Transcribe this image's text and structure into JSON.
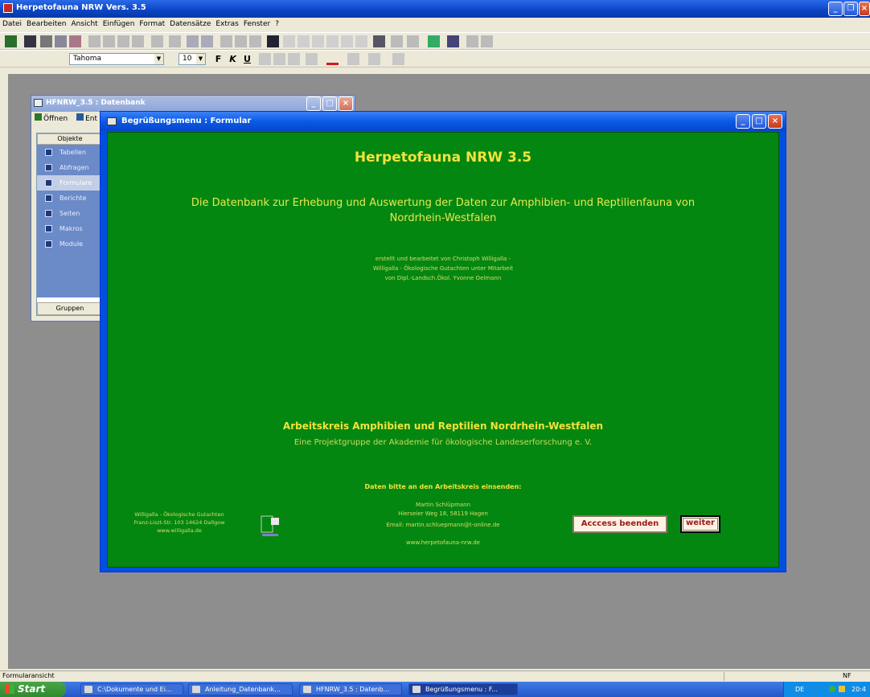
{
  "app": {
    "title": "Herpetofauna NRW Vers. 3.5"
  },
  "menu": [
    "Datei",
    "Bearbeiten",
    "Ansicht",
    "Einfügen",
    "Format",
    "Datensätze",
    "Extras",
    "Fenster",
    "?"
  ],
  "formatting": {
    "font_name": "Tahoma",
    "font_size": "10",
    "bold_label": "F",
    "italic_label": "K",
    "underline_label": "U"
  },
  "db_window": {
    "title": "HFNRW_3.5 : Datenbank",
    "open_label": "Öffnen",
    "design_label": "Ent",
    "objects_header": "Objekte",
    "objects": [
      "Tabellen",
      "Abfragen",
      "Formulare",
      "Berichte",
      "Seiten",
      "Makros",
      "Module"
    ],
    "selected_object": "Formulare",
    "groups_label": "Gruppen"
  },
  "form": {
    "window_title": "Begrüßungsmenu : Formular",
    "heading": "Herpetofauna NRW 3.5",
    "subtitle_line1": "Die Datenbank zur Erhebung und Auswertung der Daten zur Amphibien- und Reptilienfauna von",
    "subtitle_line2": "Nordrhein-Westfalen",
    "credits_line1": "erstellt und bearbeitet von Christoph Willigalla -",
    "credits_line2": "Willigalla - Ökologische Gutachten unter Mitarbeit",
    "credits_line3": "von Dipl.-Landsch.Ökol. Yvonne Oelmann",
    "org_title": "Arbeitskreis Amphibien und Reptilien Nordrhein-Westfalen",
    "org_subtitle": "Eine Projektgruppe der Akademie für ökologische Landeserforschung e. V.",
    "send_heading": "Daten bitte an den Arbeitskreis einsenden:",
    "contact_name": "Martin Schlüpmann",
    "contact_address": "Hierseier Weg 18, 58119 Hagen",
    "contact_email": "Email: martin.schluepmann@t-online.de",
    "website": "www.herpetofauna-nrw.de",
    "company_line1": "Willigalla - Ökologische Gutachten",
    "company_line2": "Franz-Liszt-Str. 103 14624 Dallgow",
    "company_line3": "www.willigalla.de",
    "quit_button": "Acccess beenden",
    "next_button": "weiter"
  },
  "status": {
    "left": "Formularansicht",
    "right": "NF"
  },
  "taskbar": {
    "start_label": "Start",
    "tasks": [
      "C:\\Dokumente und Ei...",
      "Anleitung_Datenbank...",
      "HFNRW_3.5 : Datenb...",
      "Begrüßungsmenu : F..."
    ],
    "language": "DE",
    "clock": "20:4"
  },
  "colors": {
    "form_background": "#048710",
    "heading_yellow": "#f2e23c",
    "xp_blue": "#0a5ae6"
  }
}
